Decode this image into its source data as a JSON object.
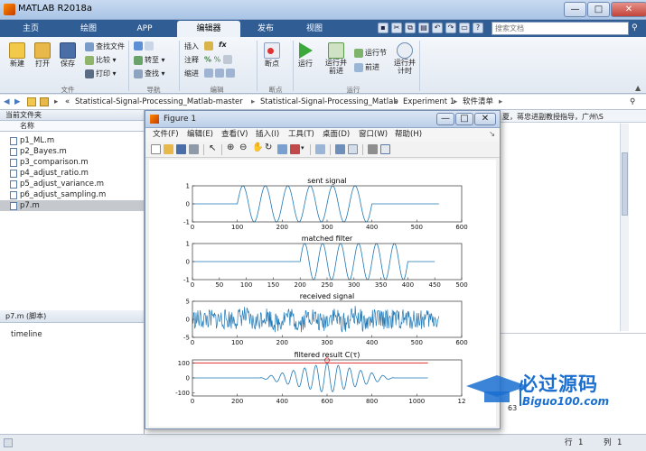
{
  "window": {
    "title": "MATLAB R2018a",
    "minimize": "—",
    "maximize": "□",
    "close": "✕"
  },
  "tabs": [
    {
      "label": "主页"
    },
    {
      "label": "绘图"
    },
    {
      "label": "APP"
    },
    {
      "label": "编辑器"
    },
    {
      "label": "发布"
    },
    {
      "label": "视图"
    }
  ],
  "search": {
    "placeholder": "搜索文档"
  },
  "ribbon": {
    "file": {
      "new": "新建",
      "open": "打开",
      "save": "保存",
      "find_files": "查找文件",
      "compare": "比较",
      "print": "打印",
      "group": "文件"
    },
    "nav": {
      "goto": "转至",
      "find": "查找",
      "group": "导航"
    },
    "edit": {
      "insert": "插入",
      "comment": "注释",
      "indent": "缩进",
      "fx": "fx",
      "group": "编辑"
    },
    "breakpoints": {
      "label": "断点",
      "group": "断点"
    },
    "run": {
      "run": "运行",
      "run_advance": "运行并\n前进",
      "run_section": "运行节",
      "advance": "前进",
      "run_time": "运行并\n计时",
      "group": "运行"
    }
  },
  "address": {
    "segments": [
      "Statistical-Signal-Processing_Matlab-master",
      "Statistical-Signal-Processing_Matlab",
      "Experiment 1",
      "软件清单"
    ]
  },
  "current_folder": {
    "title": "当前文件夹",
    "column": "名称",
    "files": [
      "p1_ML.m",
      "p2_Bayes.m",
      "p3_comparison.m",
      "p4_adjust_ratio.m",
      "p5_adjust_variance.m",
      "p6_adjust_sampling.m",
      "p7.m"
    ],
    "selected": "p7.m"
  },
  "details": {
    "title": "p7.m  (脚本)",
    "content": "timeline"
  },
  "command_window": {
    "snippet": "夏，蒋忠进副教授指导，广州\\S",
    "partial": "63"
  },
  "status": {
    "line_label": "行",
    "line": "1",
    "col_label": "列",
    "col": "1"
  },
  "figure": {
    "title": "Figure 1",
    "menu": [
      "文件(F)",
      "编辑(E)",
      "查看(V)",
      "插入(I)",
      "工具(T)",
      "桌面(D)",
      "窗口(W)",
      "帮助(H)"
    ],
    "subplots": [
      {
        "title": "sent signal",
        "xticks": [
          "0",
          "100",
          "200",
          "300",
          "400",
          "500",
          "600"
        ],
        "yticks": [
          "1",
          "0",
          "-1"
        ]
      },
      {
        "title": "matched filter",
        "xticks": [
          "0",
          "50",
          "100",
          "150",
          "200",
          "250",
          "300",
          "350",
          "400",
          "450",
          "500"
        ],
        "yticks": [
          "1",
          "0",
          "-1"
        ]
      },
      {
        "title": "received signal",
        "xticks": [
          "0",
          "100",
          "200",
          "300",
          "400",
          "500",
          "600"
        ],
        "yticks": [
          "5",
          "0",
          "-5"
        ]
      },
      {
        "title": "filtered result C(τ)",
        "xticks": [
          "0",
          "200",
          "400",
          "600",
          "800",
          "1000",
          "12"
        ],
        "yticks": [
          "100",
          "0",
          "-100"
        ]
      }
    ]
  },
  "chart_data": [
    {
      "type": "line",
      "title": "sent signal",
      "xlim": [
        0,
        600
      ],
      "ylim": [
        -1,
        1
      ],
      "series": [
        {
          "segments": [
            [
              0,
              100,
              0
            ],
            [
              100,
              400,
              "sinusoid, 6 cycles, amplitude 1"
            ],
            [
              400,
              550,
              0
            ]
          ]
        }
      ]
    },
    {
      "type": "line",
      "title": "matched filter",
      "xlim": [
        0,
        500
      ],
      "ylim": [
        -1,
        1
      ],
      "series": [
        {
          "segments": [
            [
              0,
              200,
              0
            ],
            [
              200,
              400,
              "sinusoid, 6 cycles, amplitude 1"
            ],
            [
              400,
              450,
              0
            ]
          ]
        }
      ]
    },
    {
      "type": "line",
      "title": "received signal",
      "xlim": [
        0,
        600
      ],
      "ylim": [
        -5,
        5
      ],
      "series": [
        {
          "description": "noisy signal, x 0-550, amplitude about ±4"
        }
      ]
    },
    {
      "type": "line",
      "title": "filtered result C(τ)",
      "xlim": [
        0,
        1200
      ],
      "ylim": [
        -120,
        120
      ],
      "series": [
        {
          "description": "correlation output peaking near x=600 at about 100, x range 0-1050"
        }
      ],
      "threshold": 100,
      "threshold_color": "#e03030",
      "peak_marker_x": 600
    }
  ],
  "colors": {
    "ribbon_tab": "#2f5d94",
    "line": "#1f77b4",
    "threshold": "#e03030",
    "watermark": "#1a6fd0"
  },
  "watermark": {
    "title": "必过源码",
    "url": "Biguo100.com"
  }
}
